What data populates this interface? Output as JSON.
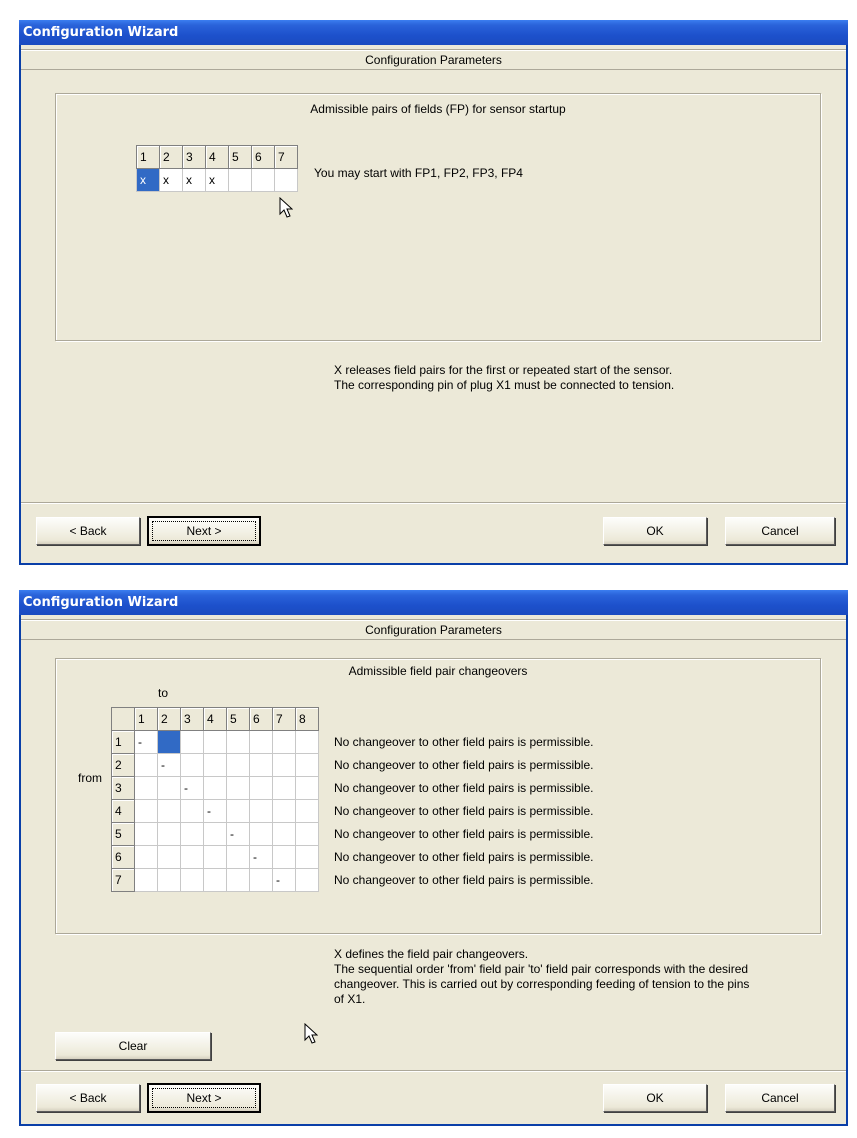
{
  "window1": {
    "title": "Configuration Wizard",
    "header": "Configuration Parameters",
    "group_title": "Admissible pairs of fields (FP) for sensor startup",
    "columns": [
      "1",
      "2",
      "3",
      "4",
      "5",
      "6",
      "7"
    ],
    "row": [
      "x",
      "x",
      "x",
      "x",
      "",
      "",
      ""
    ],
    "selected_col": 0,
    "side_text": "You may start with FP1, FP2, FP3, FP4",
    "info": "X releases field pairs for the first or repeated start of the sensor.\nThe corresponding pin of plug X1 must be connected to tension.",
    "buttons": {
      "back": "< Back",
      "next": "Next >",
      "ok": "OK",
      "cancel": "Cancel"
    }
  },
  "window2": {
    "title": "Configuration Wizard",
    "header": "Configuration Parameters",
    "group_title": "Admissible field pair changeovers",
    "to_label": "to",
    "from_label": "from",
    "columns": [
      "1",
      "2",
      "3",
      "4",
      "5",
      "6",
      "7",
      "8"
    ],
    "rows": [
      {
        "label": "1",
        "cells": [
          "-",
          "",
          "",
          "",
          "",
          "",
          "",
          ""
        ],
        "msg": "No changeover to other field pairs is permissible."
      },
      {
        "label": "2",
        "cells": [
          "",
          "-",
          "",
          "",
          "",
          "",
          "",
          ""
        ],
        "msg": "No changeover to other field pairs is permissible."
      },
      {
        "label": "3",
        "cells": [
          "",
          "",
          "-",
          "",
          "",
          "",
          "",
          ""
        ],
        "msg": "No changeover to other field pairs is permissible."
      },
      {
        "label": "4",
        "cells": [
          "",
          "",
          "",
          "-",
          "",
          "",
          "",
          ""
        ],
        "msg": "No changeover to other field pairs is permissible."
      },
      {
        "label": "5",
        "cells": [
          "",
          "",
          "",
          "",
          "-",
          "",
          "",
          ""
        ],
        "msg": "No changeover to other field pairs is permissible."
      },
      {
        "label": "6",
        "cells": [
          "",
          "",
          "",
          "",
          "",
          "-",
          "",
          ""
        ],
        "msg": "No changeover to other field pairs is permissible."
      },
      {
        "label": "7",
        "cells": [
          "",
          "",
          "",
          "",
          "",
          "",
          "-",
          ""
        ],
        "msg": "No changeover to other field pairs is permissible."
      }
    ],
    "selected_cell": {
      "row": 0,
      "col": 1
    },
    "info": "X defines the field pair changeovers.\nThe sequential order 'from' field pair 'to' field pair corresponds with the desired\nchangeover. This is carried out by corresponding feeding of tension to the pins\nof X1.",
    "clear_label": "Clear",
    "buttons": {
      "back": "< Back",
      "next": "Next >",
      "ok": "OK",
      "cancel": "Cancel"
    }
  },
  "colors": {
    "titlebar": "#1d51cc",
    "window_bg": "#ece9d8",
    "selection": "#316ac5"
  },
  "icons": [
    "arrow-cursor-icon"
  ]
}
